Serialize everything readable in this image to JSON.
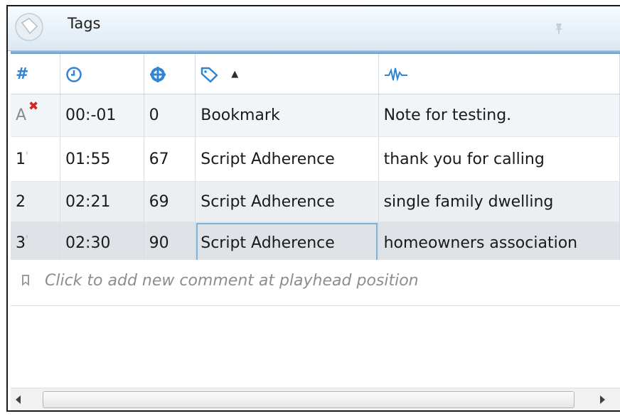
{
  "panel": {
    "title": "Tags",
    "title_icon": "tag-icon",
    "pin_icon": "pin-icon"
  },
  "columns": {
    "number": "#",
    "time_icon": "clock-icon",
    "confidence_icon": "target-icon",
    "tag_icon": "tag-icon",
    "sort_indicator": "▲",
    "text_icon": "waveform-icon"
  },
  "rows": [
    {
      "num": "A",
      "time": "00:-01",
      "score": "0",
      "tag": "Bookmark",
      "text": "Note for testing."
    },
    {
      "num": "1",
      "time": "01:55",
      "score": "67",
      "tag": "Script Adherence",
      "text": "thank you for calling"
    },
    {
      "num": "2",
      "time": "02:21",
      "score": "69",
      "tag": "Script Adherence",
      "text": "single family dwelling"
    },
    {
      "num": "3",
      "time": "02:30",
      "score": "90",
      "tag": "Script Adherence",
      "text": "homeowners association"
    }
  ],
  "bookmark_delete_mark": "✖",
  "add_comment": {
    "text": "Click to add new comment at playhead position",
    "icon": "bookmark-icon"
  },
  "colors": {
    "accent_blue": "#2f85d2",
    "delete_red": "#d42424"
  }
}
